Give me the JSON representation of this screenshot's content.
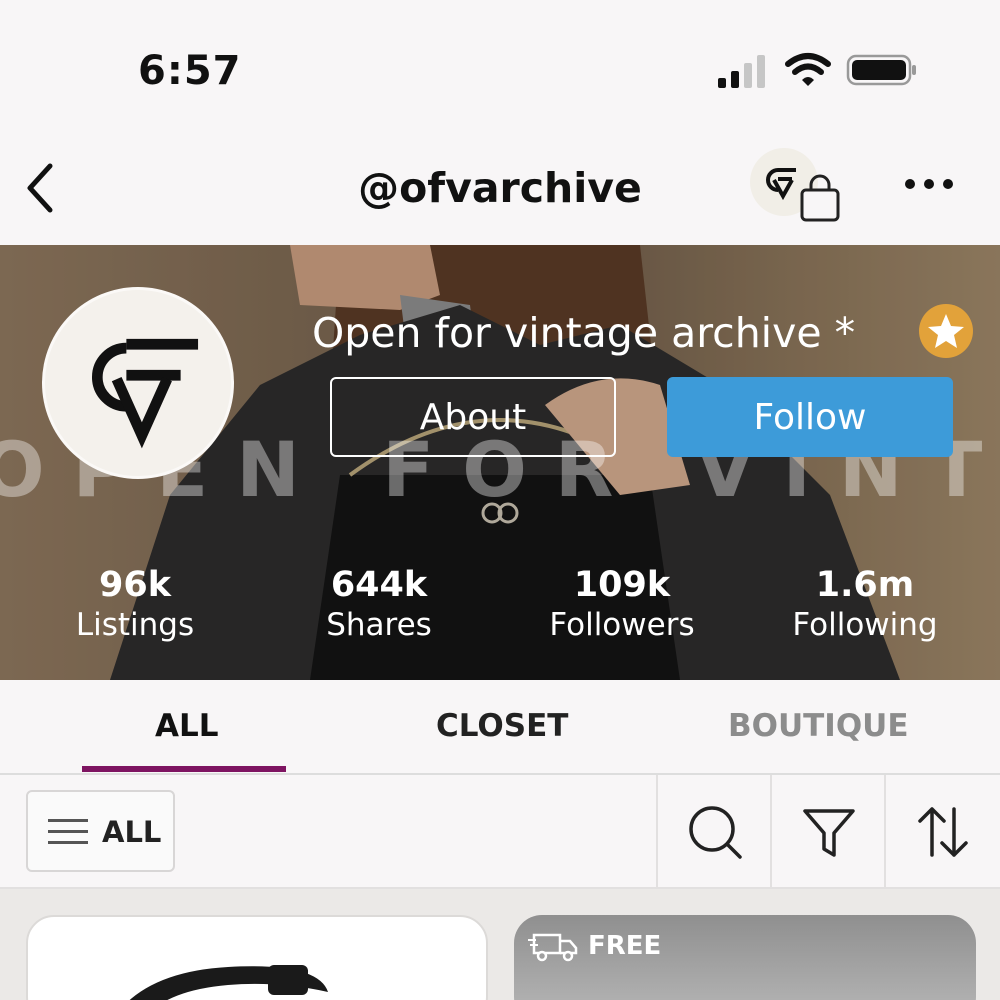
{
  "status_bar": {
    "time": "6:57",
    "signal_icon": "cellular-signal-icon",
    "wifi_icon": "wifi-icon",
    "battery_icon": "battery-icon"
  },
  "nav": {
    "title": "@ofvarchive",
    "back_icon": "chevron-left-icon",
    "bag_icon": "shopping-bag-icon",
    "more_icon": "more-horizontal-icon"
  },
  "profile": {
    "name": "Open for vintage archive *",
    "watermark": "OPEN FOR VINTAGE",
    "about_label": "About",
    "follow_label": "Follow",
    "follow_color": "#3d9bd9",
    "star_badge_color": "#e2a23a",
    "stats": [
      {
        "value": "96k",
        "label": "Listings"
      },
      {
        "value": "644k",
        "label": "Shares"
      },
      {
        "value": "109k",
        "label": "Followers"
      },
      {
        "value": "1.6m",
        "label": "Following"
      }
    ]
  },
  "tabs": [
    {
      "label": "ALL",
      "active": true
    },
    {
      "label": "CLOSET",
      "active": false
    },
    {
      "label": "BOUTIQUE",
      "active": false
    }
  ],
  "tab_accent_color": "#7e1461",
  "filter": {
    "all_label": "ALL",
    "tools": [
      "search-icon",
      "filter-icon",
      "sort-icon"
    ]
  },
  "products": {
    "shipping_badge": "FREE"
  }
}
